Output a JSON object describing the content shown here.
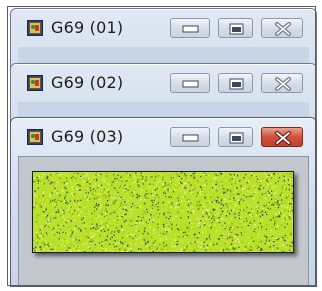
{
  "windows": [
    {
      "title": "G69 (01)",
      "active": false,
      "controls": {
        "minimize": "minimize",
        "maximize": "maximize",
        "close": "close"
      }
    },
    {
      "title": "G69 (02)",
      "active": false,
      "controls": {
        "minimize": "minimize",
        "maximize": "maximize",
        "close": "close"
      }
    },
    {
      "title": "G69 (03)",
      "active": true,
      "controls": {
        "minimize": "minimize",
        "maximize": "maximize",
        "close": "close"
      }
    }
  ],
  "icons": {
    "app": "image-app-icon",
    "minimize": "minimize-icon",
    "maximize": "maximize-icon",
    "close": "close-icon"
  },
  "colors": {
    "noise_base": "#b9e02a",
    "close_active": "#d2513c",
    "titlebar": "#cfdced"
  }
}
